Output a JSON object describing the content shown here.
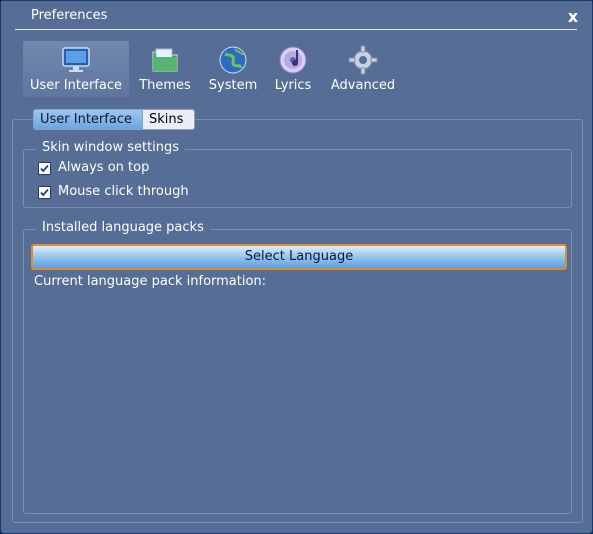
{
  "window": {
    "title": "Preferences",
    "close_glyph": "x"
  },
  "toolbar": {
    "items": [
      {
        "label": "User Interface",
        "icon": "monitor-icon"
      },
      {
        "label": "Themes",
        "icon": "folder-icon"
      },
      {
        "label": "System",
        "icon": "globe-icon"
      },
      {
        "label": "Lyrics",
        "icon": "cd-icon"
      },
      {
        "label": "Advanced",
        "icon": "gear-icon"
      }
    ]
  },
  "tabs": {
    "selected": "User Interface",
    "other": "Skins"
  },
  "skin_settings": {
    "title": "Skin window settings",
    "always_on_top": {
      "label": "Always on top",
      "checked": true
    },
    "mouse_click_through": {
      "label": "Mouse click through",
      "checked": true
    }
  },
  "language": {
    "title": "Installed language packs",
    "button": "Select Language",
    "info": "Current language pack information:"
  },
  "colors": {
    "background": "#566d95",
    "button_border": "#e08b2c",
    "accent": "#6ea5e0"
  }
}
